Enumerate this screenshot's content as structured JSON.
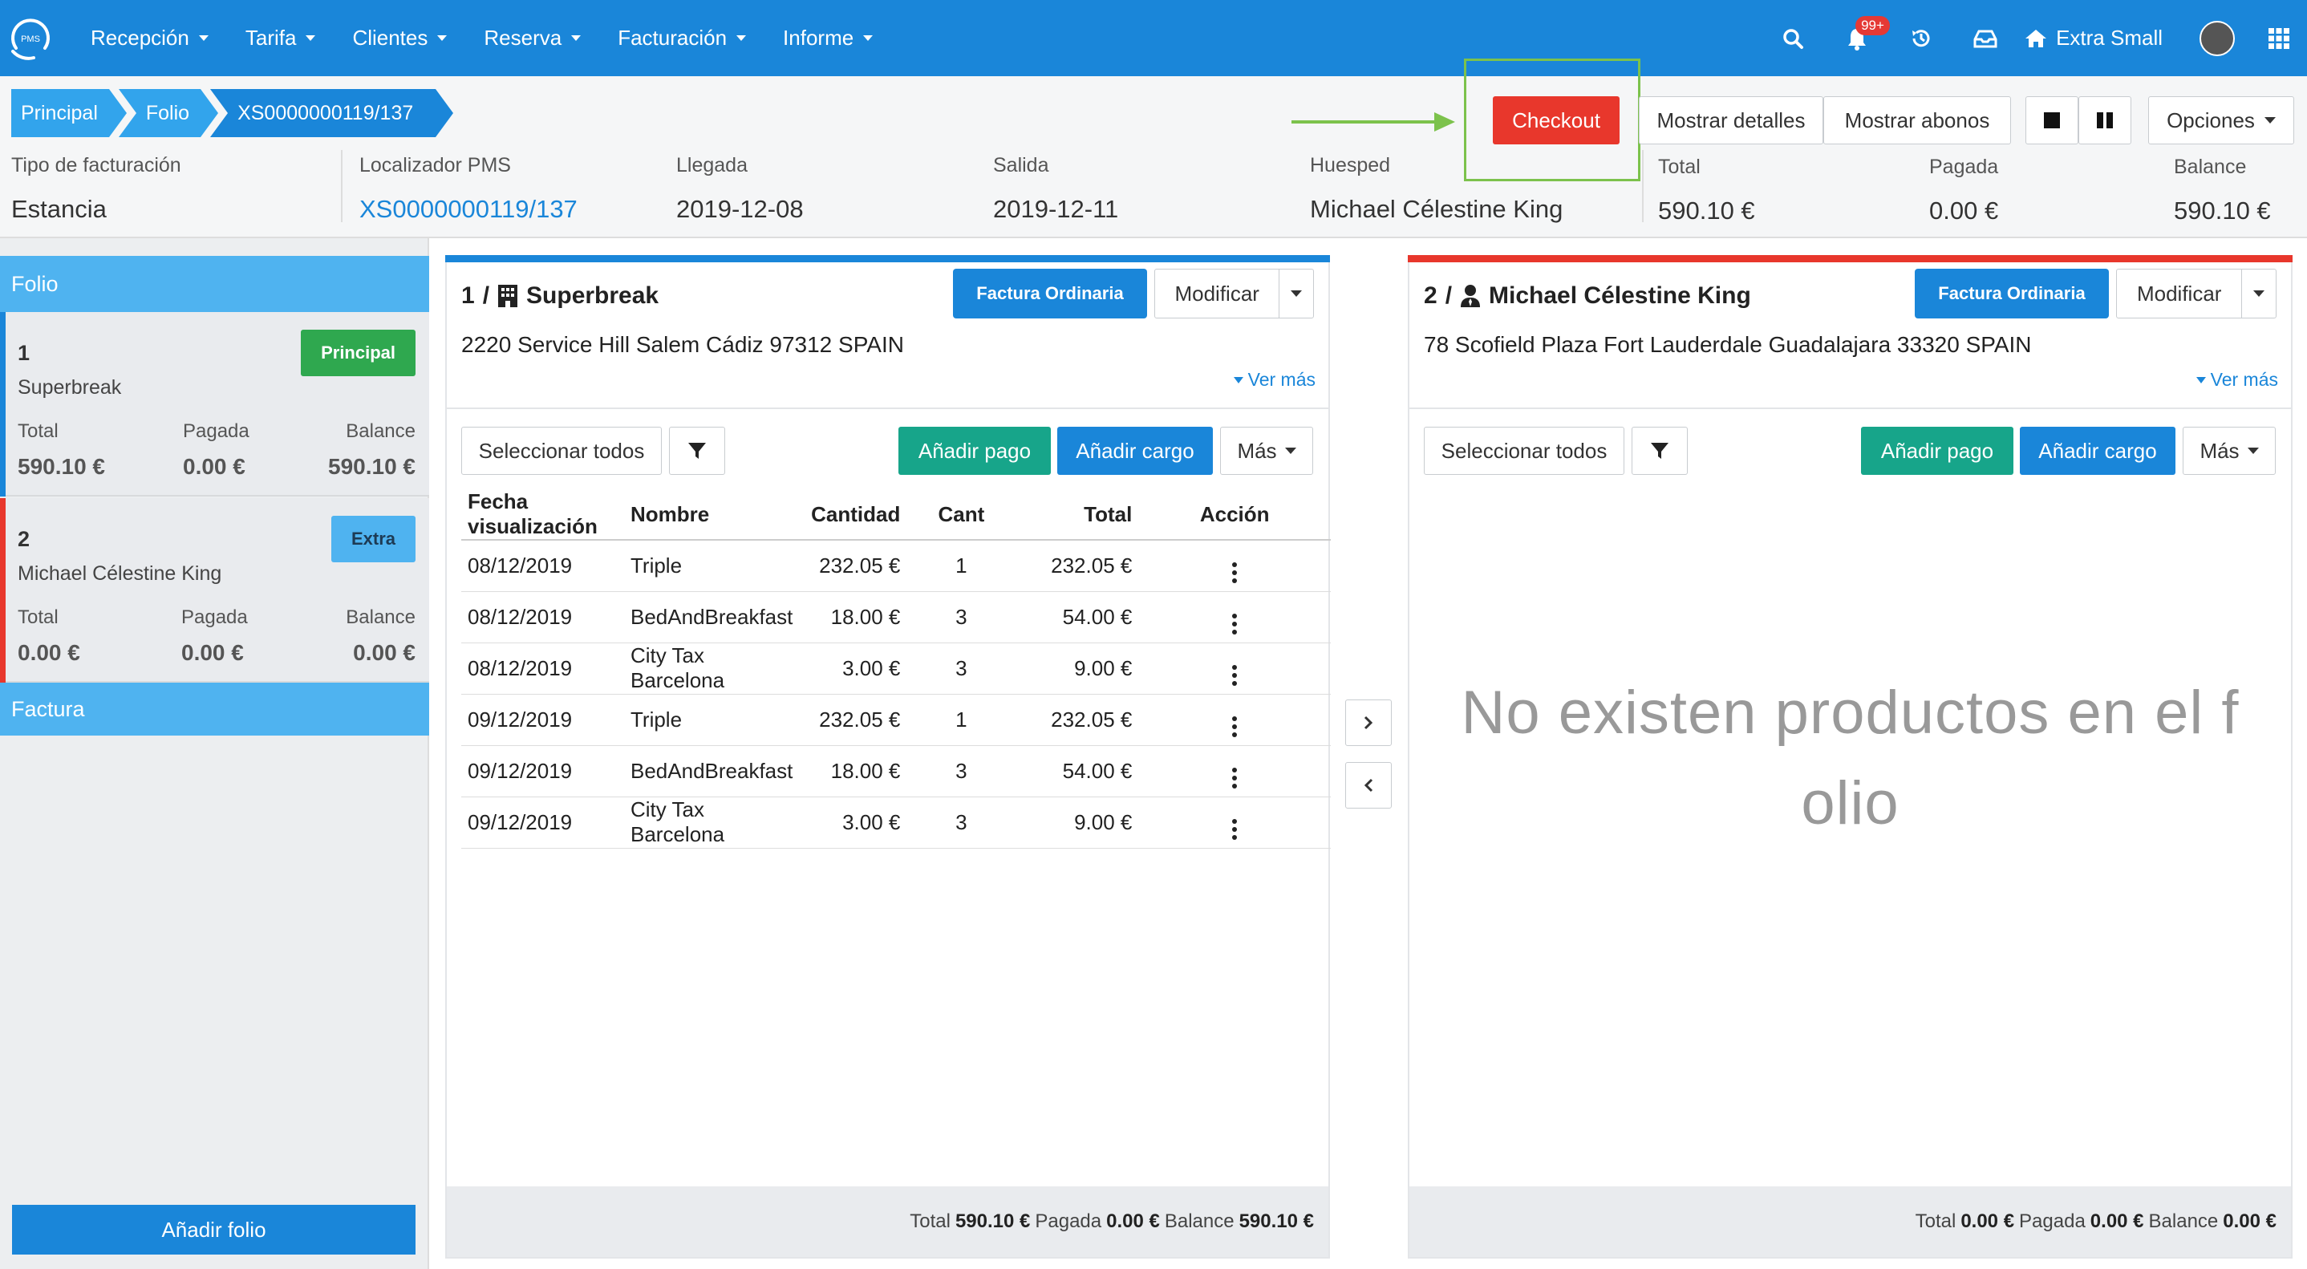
{
  "nav": {
    "logo_text": "PMS",
    "menu": [
      {
        "label": "Recepción"
      },
      {
        "label": "Tarifa"
      },
      {
        "label": "Clientes"
      },
      {
        "label": "Reserva"
      },
      {
        "label": "Facturación"
      },
      {
        "label": "Informe"
      }
    ],
    "notifications_badge": "99+",
    "home_label": "Extra Small",
    "icons": [
      "search-icon",
      "bell-icon",
      "history-icon",
      "inbox-icon",
      "home-icon",
      "avatar",
      "grid-icon"
    ]
  },
  "breadcrumb": [
    "Principal",
    "Folio",
    "XS0000000119/137"
  ],
  "actions": {
    "checkout": "Checkout",
    "show_details": "Mostrar detalles",
    "show_payments": "Mostrar abonos",
    "options": "Opciones"
  },
  "reservation": {
    "billing_type_label": "Tipo de facturación",
    "billing_type": "Estancia",
    "locator_label": "Localizador PMS",
    "locator": "XS0000000119/137",
    "arrival_label": "Llegada",
    "arrival": "2019-12-08",
    "departure_label": "Salida",
    "departure": "2019-12-11",
    "guest_label": "Huesped",
    "guest": "Michael Célestine King",
    "total_label": "Total",
    "total": "590.10 €",
    "paid_label": "Pagada",
    "paid": "0.00 €",
    "balance_label": "Balance",
    "balance": "590.10 €"
  },
  "sidebar": {
    "folio_header": "Folio",
    "factura_header": "Factura",
    "add_folio": "Añadir folio",
    "folios": [
      {
        "number": "1",
        "name": "Superbreak",
        "tag": "Principal",
        "tag_color": "#2fa84f",
        "bar_color": "#1a86d9",
        "total_label": "Total",
        "total": "590.10 €",
        "paid_label": "Pagada",
        "paid": "0.00 €",
        "balance_label": "Balance",
        "balance": "590.10 €"
      },
      {
        "number": "2",
        "name": "Michael Célestine King",
        "tag": "Extra",
        "tag_color": "#4fb3f0",
        "bar_color": "#e8372c",
        "total_label": "Total",
        "total": "0.00 €",
        "paid_label": "Pagada",
        "paid": "0.00 €",
        "balance_label": "Balance",
        "balance": "0.00 €"
      }
    ]
  },
  "panel1": {
    "number": "1",
    "sep": "/",
    "title": "Superbreak",
    "title_icon": "building-icon",
    "address": "2220 Service Hill Salem Cádiz 97312 SPAIN",
    "invoice_btn": "Factura Ordinaria",
    "modify_btn": "Modificar",
    "ver_mas": "Ver más",
    "select_all": "Seleccionar todos",
    "add_payment": "Añadir pago",
    "add_charge": "Añadir cargo",
    "more": "Más",
    "columns": [
      "Fecha visualización",
      "Nombre",
      "Cantidad",
      "Cant",
      "Total",
      "Acción"
    ],
    "rows": [
      [
        "08/12/2019",
        "Triple",
        "232.05 €",
        "1",
        "232.05 €"
      ],
      [
        "08/12/2019",
        "BedAndBreakfast",
        "18.00 €",
        "3",
        "54.00 €"
      ],
      [
        "08/12/2019",
        "City Tax Barcelona",
        "3.00 €",
        "3",
        "9.00 €"
      ],
      [
        "09/12/2019",
        "Triple",
        "232.05 €",
        "1",
        "232.05 €"
      ],
      [
        "09/12/2019",
        "BedAndBreakfast",
        "18.00 €",
        "3",
        "54.00 €"
      ],
      [
        "09/12/2019",
        "City Tax Barcelona",
        "3.00 €",
        "3",
        "9.00 €"
      ]
    ],
    "footer": {
      "total_label": "Total",
      "total": "590.10 €",
      "paid_label": "Pagada",
      "paid": "0.00 €",
      "balance_label": "Balance",
      "balance": "590.10 €"
    },
    "color": "#1a86d9"
  },
  "panel2": {
    "number": "2",
    "sep": "/",
    "title": "Michael Célestine King",
    "title_icon": "user-tie-icon",
    "address": "78 Scofield Plaza Fort Lauderdale Guadalajara 33320 SPAIN",
    "invoice_btn": "Factura Ordinaria",
    "modify_btn": "Modificar",
    "ver_mas": "Ver más",
    "select_all": "Seleccionar todos",
    "add_payment": "Añadir pago",
    "add_charge": "Añadir cargo",
    "more": "Más",
    "empty_line1": "No existen productos en el f",
    "empty_line2": "olio",
    "footer": {
      "total_label": "Total",
      "total": "0.00 €",
      "paid_label": "Pagada",
      "paid": "0.00 €",
      "balance_label": "Balance",
      "balance": "0.00 €"
    },
    "color": "#e8372c"
  },
  "colors": {
    "nav": "#1a86d9",
    "checkout": "#e8372c",
    "highlight": "#7cc24c",
    "green_btn": "#17a58a"
  }
}
